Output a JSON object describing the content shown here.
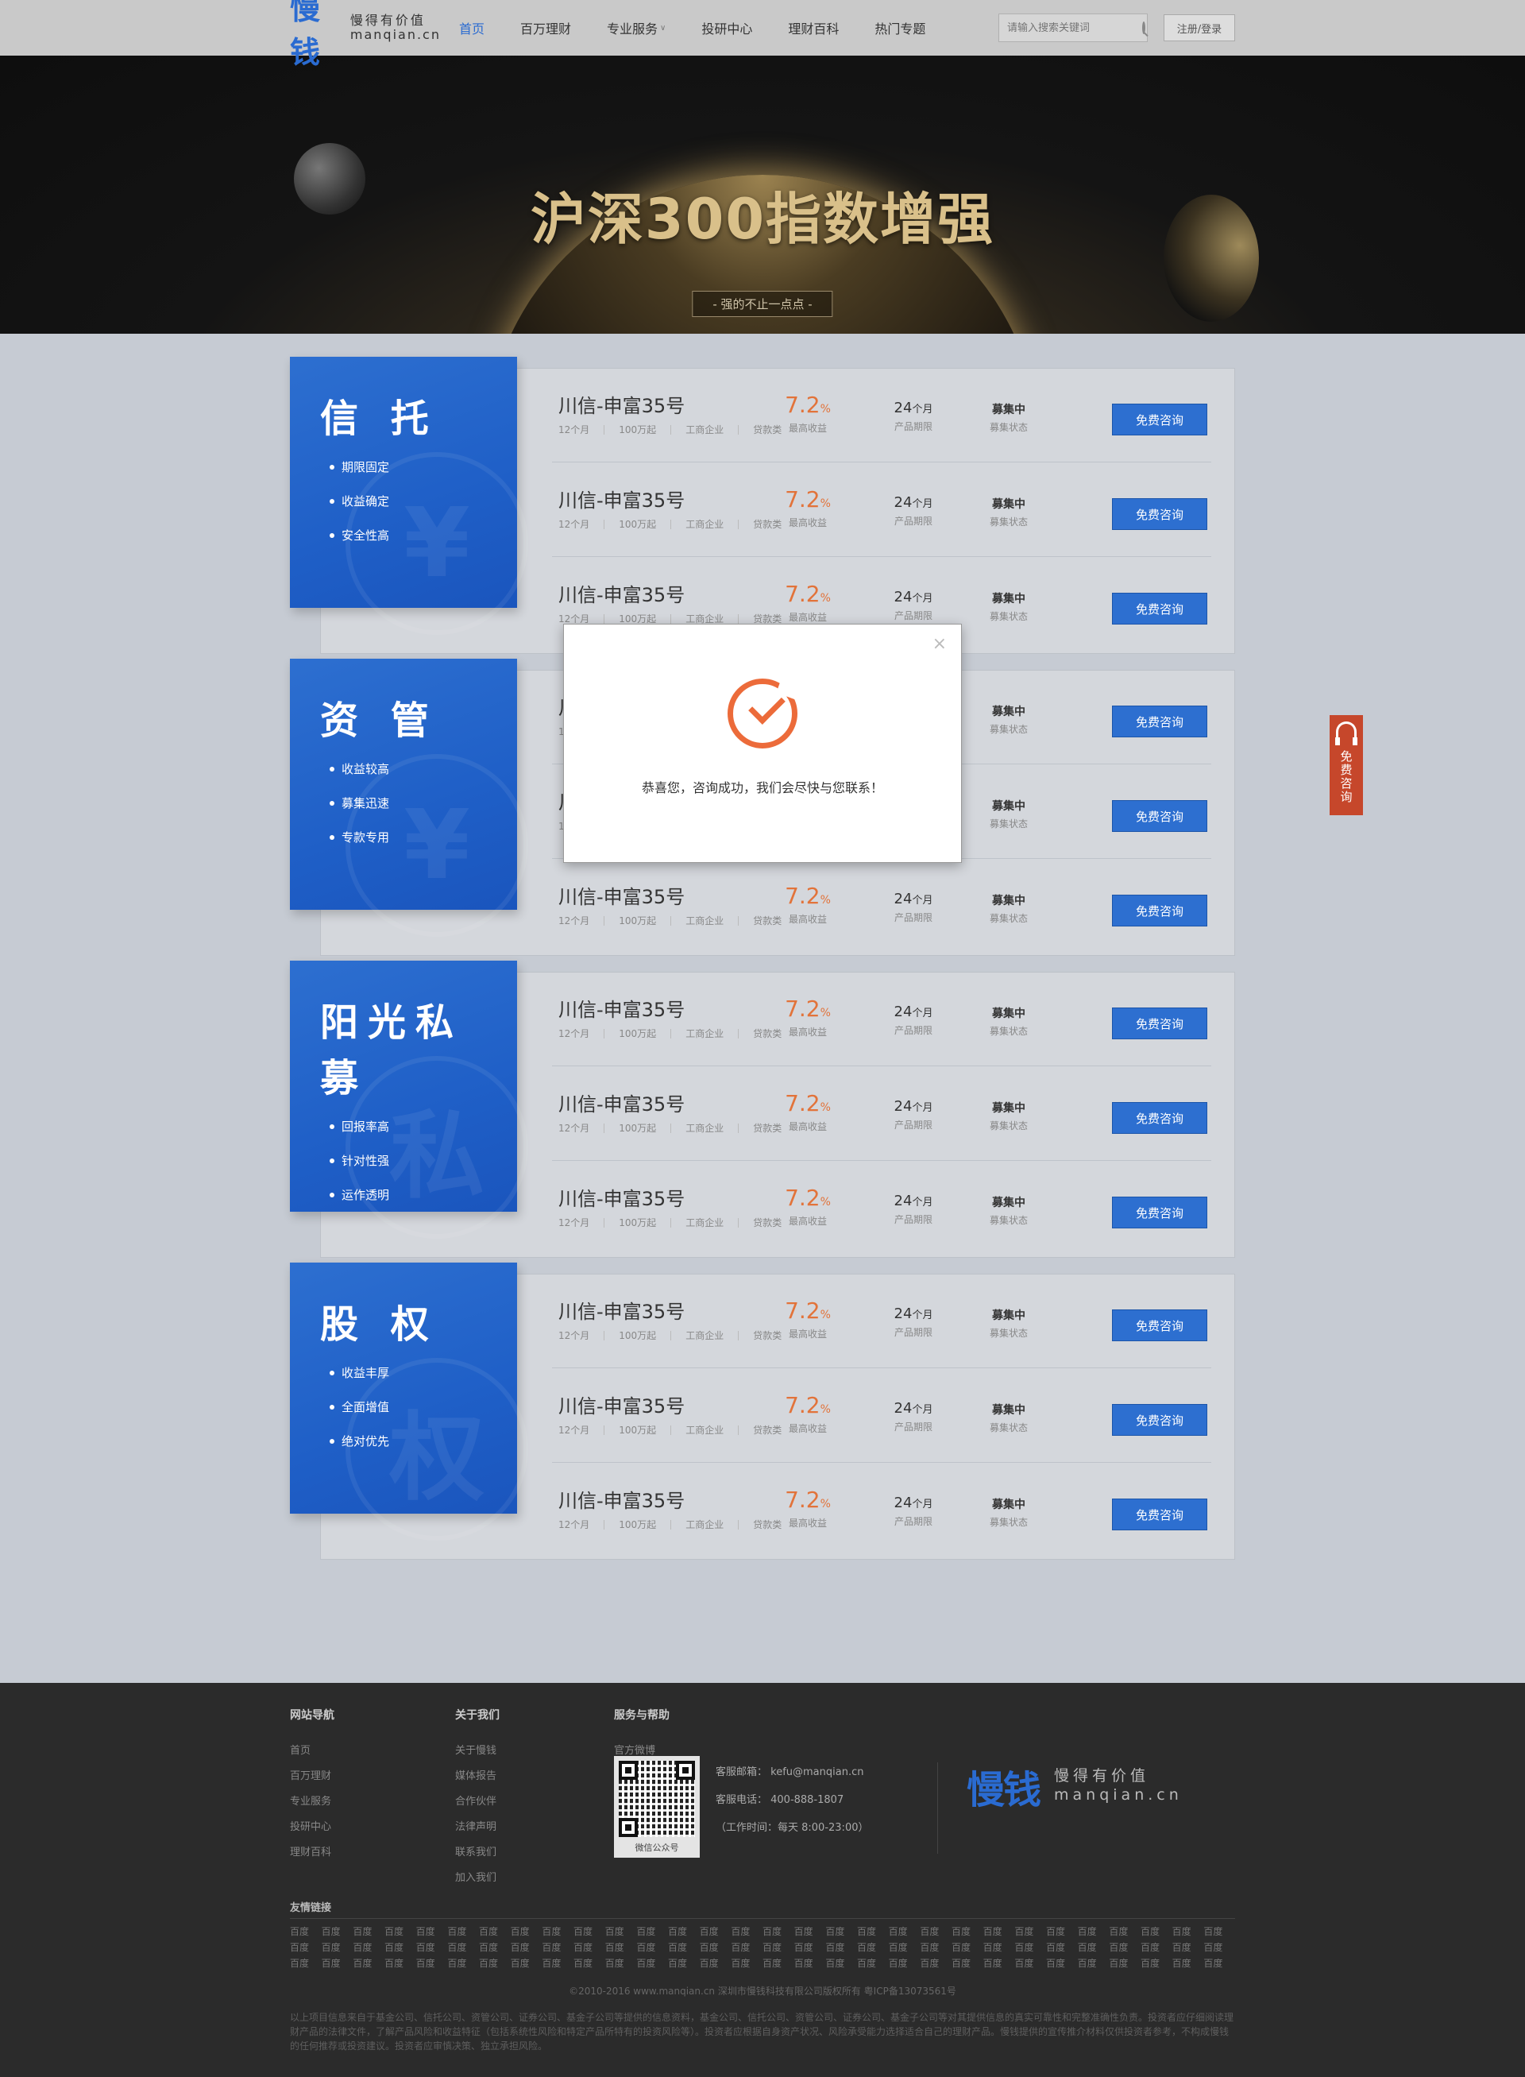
{
  "header": {
    "logo_cn": "慢钱",
    "logo_slogan": "慢得有价值",
    "logo_domain": "manqian.cn",
    "nav": [
      {
        "label": "首页",
        "active": true
      },
      {
        "label": "百万理财",
        "active": false
      },
      {
        "label": "专业服务",
        "active": false,
        "dropdown": true
      },
      {
        "label": "投研中心",
        "active": false
      },
      {
        "label": "理财百科",
        "active": false
      },
      {
        "label": "热门专题",
        "active": false
      }
    ],
    "search_placeholder": "请输入搜索关键词",
    "login_label": "注册/登录"
  },
  "banner": {
    "title": "沪深300指数增强",
    "subtitle": "- 强的不止一点点 -"
  },
  "sections": [
    {
      "title": "信 托",
      "watermark": "¥",
      "features": [
        "期限固定",
        "收益确定",
        "安全性高"
      ]
    },
    {
      "title": "资 管",
      "watermark": "¥",
      "features": [
        "收益较高",
        "募集迅速",
        "专款专用"
      ]
    },
    {
      "title": "阳光私募",
      "watermark": "私",
      "features": [
        "回报率高",
        "针对性强",
        "运作透明"
      ]
    },
    {
      "title": "股 权",
      "watermark": "权",
      "features": [
        "收益丰厚",
        "全面增值",
        "绝对优先"
      ]
    }
  ],
  "product": {
    "name": "川信-申富35号",
    "tags": [
      "12个月",
      "100万起",
      "工商企业",
      "贷款类"
    ],
    "rate_value": "7.2",
    "rate_unit": "%",
    "rate_label": "最高收益",
    "term_value": "24",
    "term_unit": "个月",
    "term_label": "产品期限",
    "status_value": "募集中",
    "status_label": "募集状态",
    "button_label": "免费咨询"
  },
  "dialog": {
    "close": "×",
    "message": "恭喜您，咨询成功，我们会尽快与您联系！",
    "accent": "#ec6b3a"
  },
  "side_float": {
    "label": "免费咨询"
  },
  "footer": {
    "col1_title": "网站导航",
    "col1_links": [
      "首页",
      "百万理财",
      "专业服务",
      "投研中心",
      "理财百科"
    ],
    "col2_title": "关于我们",
    "col2_links": [
      "关于慢钱",
      "媒体报告",
      "合作伙伴",
      "法律声明",
      "联系我们",
      "加入我们"
    ],
    "col3_title": "服务与帮助",
    "weibo": "官方微博",
    "qr_caption": "微信公众号",
    "email": "客服邮箱：  kefu@manqian.cn",
    "phone": "客服电话：  400-888-1807",
    "hours": "（工作时间：每天  8:00-23:00）",
    "logo_cn": "慢钱",
    "logo_slogan": "慢得有价值",
    "logo_domain": "manqian.cn",
    "links_title": "友情链接",
    "link_text": "百度",
    "copyright": "©2010-2016 www.manqian.cn 深圳市慢钱科技有限公司版权所有    粤ICP备13073561号",
    "notice": "以上项目信息来自于基金公司、信托公司、资管公司、证券公司、基金子公司等提供的信息资料，基金公司、信托公司、资管公司、证券公司、基金子公司等对其提供信息的真实可靠性和完整准确性负责。投资者应仔细阅读理财产品的法律文件，了解产品风险和收益特征（包括系统性风险和特定产品所特有的投资风险等）。投资者应根据自身资产状况、风险承受能力选择适合自己的理财产品。慢钱提供的宣传推介材料仅供投资者参考，不构成慢钱的任何推荐或投资建议。投资者应审慎决策、独立承担风险。"
  },
  "colors": {
    "brand": "#2a6bd1",
    "accent": "#e2733a",
    "float": "#c6472b"
  }
}
